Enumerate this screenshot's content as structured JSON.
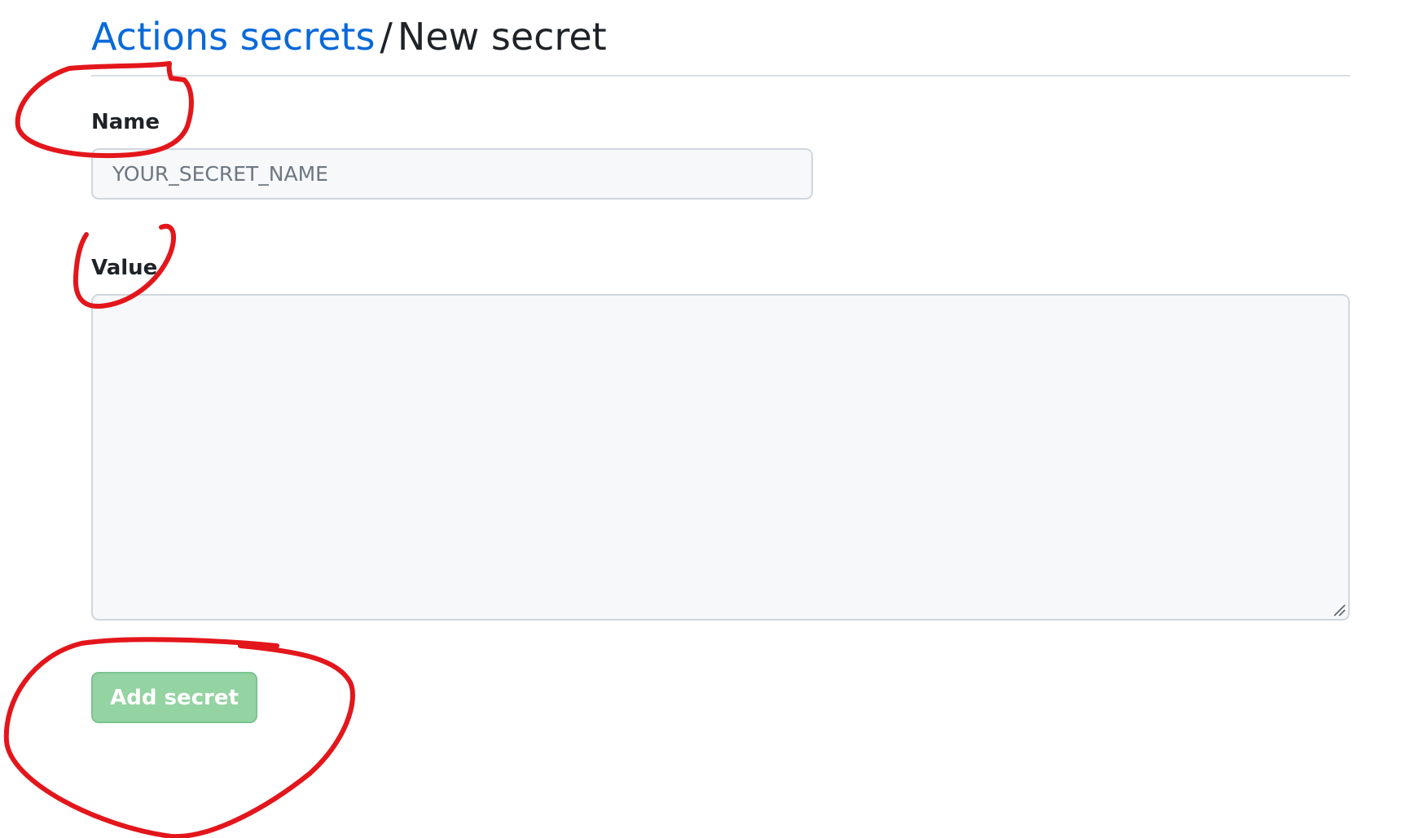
{
  "breadcrumb": {
    "parent_label": "Actions secrets",
    "separator": "/",
    "current_label": "New secret"
  },
  "form": {
    "name_label": "Name",
    "name_placeholder": "YOUR_SECRET_NAME",
    "name_value": "",
    "value_label": "Value",
    "value_value": "",
    "submit_label": "Add secret",
    "submit_disabled": true
  },
  "colors": {
    "link": "#0969da",
    "button_disabled_bg": "#94d3a2",
    "annotation_red": "#e3161b"
  },
  "icons": {
    "resize_handle": "textarea-resize-icon"
  }
}
